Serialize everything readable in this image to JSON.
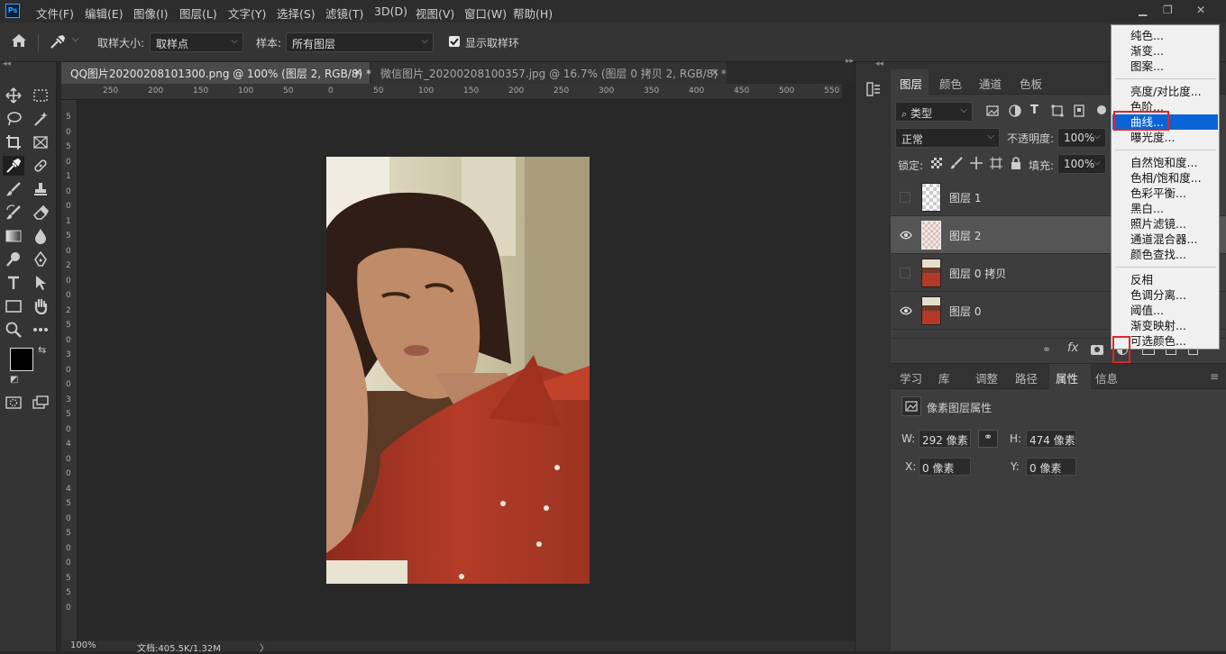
{
  "app": {
    "logo": "Ps"
  },
  "menubar": {
    "items": [
      "文件(F)",
      "编辑(E)",
      "图像(I)",
      "图层(L)",
      "文字(Y)",
      "选择(S)",
      "滤镜(T)",
      "3D(D)",
      "视图(V)",
      "窗口(W)",
      "帮助(H)"
    ]
  },
  "options": {
    "sample_size_label": "取样大小:",
    "sample_size_value": "取样点",
    "sample_label": "样本:",
    "sample_value": "所有图层",
    "show_ring_label": "显示取样环"
  },
  "tabs": [
    {
      "label": "QQ图片20200208101300.png @ 100% (图层 2, RGB/8) *",
      "close": "×"
    },
    {
      "label": "微信图片_20200208100357.jpg @ 16.7% (图层 0 拷贝 2, RGB/8) *",
      "close": "×"
    }
  ],
  "ruler": {
    "h_ticks": [
      "250",
      "200",
      "150",
      "100",
      "50",
      "0",
      "50",
      "100",
      "150",
      "200",
      "250",
      "300",
      "350",
      "400",
      "450",
      "500",
      "550"
    ],
    "v_ticks": [
      "5",
      "0",
      "5",
      "0",
      "1",
      "0",
      "0",
      "1",
      "5",
      "0",
      "2",
      "0",
      "0",
      "2",
      "5",
      "0",
      "3",
      "0",
      "0",
      "3",
      "5",
      "0",
      "4",
      "0",
      "0",
      "4",
      "5",
      "0",
      "5",
      "0",
      "0",
      "5",
      "5",
      "0"
    ]
  },
  "status": {
    "zoom": "100%",
    "doc": "文档:405.5K/1.32M",
    "arrow": "〉"
  },
  "layers_panel": {
    "tabs": [
      "图层",
      "颜色",
      "通道",
      "色板"
    ],
    "filter_label": "类型",
    "blend_mode": "正常",
    "opacity_label": "不透明度:",
    "opacity_value": "100%",
    "lock_label": "锁定:",
    "fill_label": "填充:",
    "fill_value": "100%",
    "layers": [
      {
        "name": "图层 1",
        "visible": false,
        "selected": false,
        "thumb": "transparent"
      },
      {
        "name": "图层 2",
        "visible": true,
        "selected": true,
        "thumb": "pattern"
      },
      {
        "name": "图层 0 拷贝",
        "visible": false,
        "selected": false,
        "thumb": "photo"
      },
      {
        "name": "图层 0",
        "visible": true,
        "selected": false,
        "thumb": "photo"
      }
    ],
    "footer_fx": "fx"
  },
  "properties_panel": {
    "tabs": [
      "学习",
      "库",
      "调整",
      "路径",
      "属性",
      "信息"
    ],
    "active_tab": "属性",
    "title": "像素图层属性",
    "w_label": "W:",
    "w_value": "292 像素",
    "h_label": "H:",
    "h_value": "474 像素",
    "x_label": "X:",
    "x_value": "0 像素",
    "y_label": "Y:",
    "y_value": "0 像素"
  },
  "adjustment_menu": {
    "groups": [
      [
        "纯色...",
        "渐变...",
        "图案..."
      ],
      [
        "亮度/对比度...",
        "色阶...",
        "曲线...",
        "曝光度..."
      ],
      [
        "自然饱和度...",
        "色相/饱和度...",
        "色彩平衡...",
        "黑白...",
        "照片滤镜...",
        "通道混合器...",
        "颜色查找..."
      ],
      [
        "反相",
        "色调分离...",
        "阈值...",
        "渐变映射...",
        "可选颜色..."
      ]
    ],
    "highlighted": "曲线..."
  },
  "colors": {
    "accent": "#0a64d6",
    "annotation_red": "#e0242a",
    "ps_blue": "#31a8ff"
  }
}
